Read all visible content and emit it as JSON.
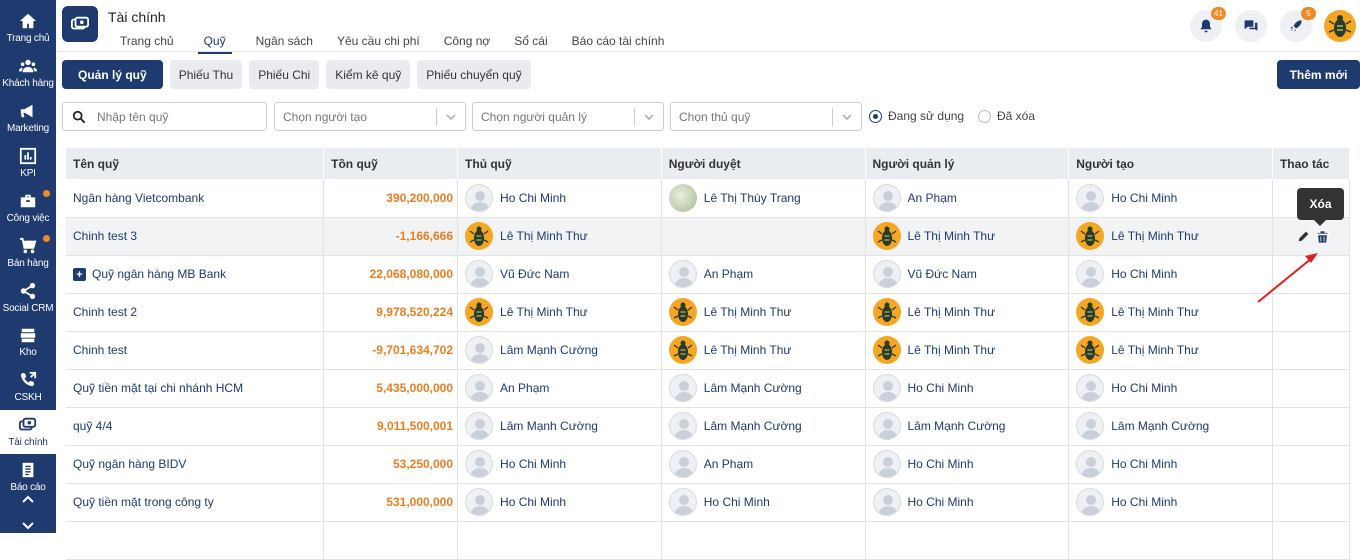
{
  "nav": [
    {
      "label": "Trang chủ",
      "icon": "home-icon"
    },
    {
      "label": "Khách hàng",
      "icon": "users-icon"
    },
    {
      "label": "Marketing",
      "icon": "megaphone-icon"
    },
    {
      "label": "KPI",
      "icon": "chart-icon"
    },
    {
      "label": "Công việc",
      "icon": "briefcase-icon"
    },
    {
      "label": "Bán hàng",
      "icon": "cart-icon"
    },
    {
      "label": "Social CRM",
      "icon": "share-icon"
    },
    {
      "label": "Kho",
      "icon": "warehouse-icon"
    },
    {
      "label": "CSKH",
      "icon": "phone-icon"
    },
    {
      "label": "Tài chính",
      "icon": "money-icon"
    },
    {
      "label": "Báo cáo",
      "icon": "report-icon"
    }
  ],
  "header": {
    "title": "Tài chính",
    "tabs": [
      "Trang chủ",
      "Quỹ",
      "Ngân sách",
      "Yêu cầu chi phí",
      "Công nợ",
      "Sổ cái",
      "Báo cáo tài chính"
    ],
    "active_tab": "Quỹ",
    "notifications_count": "41",
    "rocket_count": "5"
  },
  "subtabs": [
    "Quản lý quỹ",
    "Phiếu Thu",
    "Phiếu Chi",
    "Kiểm kê quỹ",
    "Phiếu chuyển quỹ"
  ],
  "add_button": "Thêm mới",
  "filters": {
    "search_placeholder": "Nhập tên quỹ",
    "creator_placeholder": "Chọn người tạo",
    "manager_placeholder": "Chọn người quản lý",
    "keeper_placeholder": "Chọn thủ quỹ",
    "status_in_use": "Đang sử dụng",
    "status_deleted": "Đã xóa",
    "selected_status": "Đang sử dụng"
  },
  "table": {
    "headers": [
      "Tên quỹ",
      "Tồn quỹ",
      "Thủ quỹ",
      "Người duyệt",
      "Người quản lý",
      "Người tạo",
      "Thao tác"
    ],
    "rows": [
      {
        "name": "Ngân hàng Vietcombank",
        "balance": "390,200,000",
        "keeper": "Ho Chi Minh",
        "keeper_av": "gen",
        "approver": "Lê Thị Thùy Trang",
        "approver_av": "photo",
        "manager": "An Phạm",
        "manager_av": "gen",
        "creator": "Ho Chi Minh",
        "creator_av": "gen"
      },
      {
        "name": "Chinh test 3",
        "balance": "-1,166,666",
        "keeper": "Lê Thị Minh Thư",
        "keeper_av": "bug",
        "approver": "",
        "approver_av": "",
        "manager": "Lê Thị Minh Thư",
        "manager_av": "bug",
        "creator": "Lê Thị Minh Thư",
        "creator_av": "bug",
        "highlight": true
      },
      {
        "name": "Quỹ ngân hàng MB Bank",
        "balance": "22,068,080,000",
        "keeper": "Vũ Đức Nam",
        "keeper_av": "gen",
        "approver": "An Phạm",
        "approver_av": "gen",
        "manager": "Vũ Đức Nam",
        "manager_av": "gen",
        "creator": "Ho Chi Minh",
        "creator_av": "gen",
        "expandable": true
      },
      {
        "name": "Chinh test 2",
        "balance": "9,978,520,224",
        "keeper": "Lê Thị Minh Thư",
        "keeper_av": "bug",
        "approver": "Lê Thị Minh Thư",
        "approver_av": "bug",
        "manager": "Lê Thị Minh Thư",
        "manager_av": "bug",
        "creator": "Lê Thị Minh Thư",
        "creator_av": "bug"
      },
      {
        "name": "Chinh test",
        "balance": "-9,701,634,702",
        "keeper": "Lâm Mạnh Cường",
        "keeper_av": "gen",
        "approver": "Lê Thị Minh Thư",
        "approver_av": "bug",
        "manager": "Lê Thị Minh Thư",
        "manager_av": "bug",
        "creator": "Lê Thị Minh Thư",
        "creator_av": "bug"
      },
      {
        "name": "Quỹ tiền mặt tại chi nhánh HCM",
        "balance": "5,435,000,000",
        "keeper": "An Phạm",
        "keeper_av": "gen",
        "approver": "Lâm Mạnh Cường",
        "approver_av": "gen",
        "manager": "Ho Chi Minh",
        "manager_av": "gen",
        "creator": "Ho Chi Minh",
        "creator_av": "gen"
      },
      {
        "name": "quỹ 4/4",
        "balance": "9,011,500,001",
        "keeper": "Lâm Mạnh Cường",
        "keeper_av": "gen",
        "approver": "Lâm Mạnh Cường",
        "approver_av": "gen",
        "manager": "Lâm Mạnh Cường",
        "manager_av": "gen",
        "creator": "Lâm Mạnh Cường",
        "creator_av": "gen"
      },
      {
        "name": "Quỹ ngân hàng BIDV",
        "balance": "53,250,000",
        "keeper": "Ho Chi Minh",
        "keeper_av": "gen",
        "approver": "An Phạm",
        "approver_av": "gen",
        "manager": "Ho Chi Minh",
        "manager_av": "gen",
        "creator": "Ho Chi Minh",
        "creator_av": "gen"
      },
      {
        "name": "Quỹ tiền mặt trong công ty",
        "balance": "531,000,000",
        "keeper": "Ho Chi Minh",
        "keeper_av": "gen",
        "approver": "Ho Chi Minh",
        "approver_av": "gen",
        "manager": "Ho Chi Minh",
        "manager_av": "gen",
        "creator": "Ho Chi Minh",
        "creator_av": "gen"
      }
    ]
  },
  "tooltip": "Xóa",
  "colors": {
    "brand": "#1e3a6e",
    "accent": "#f08a24",
    "negative_amount": "#e67e22",
    "annotation_arrow": "#e02020"
  }
}
